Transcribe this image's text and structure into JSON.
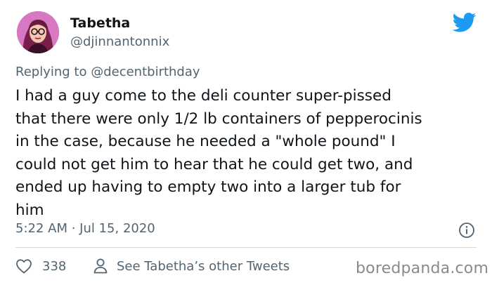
{
  "author": {
    "name": "Tabetha",
    "handle": "@djinnantonnix"
  },
  "reply": {
    "prefix": "Replying to ",
    "mention": "@decentbirthday"
  },
  "tweet": {
    "lines": [
      "I had a guy come to the deli counter super-pissed",
      "that there were only 1/2 lb containers of pepperocinis",
      "in the case, because he needed a \"whole pound\" I",
      "could not get him to hear that he could get two, and",
      "ended up having to empty two into a larger tub for",
      "him"
    ],
    "timestamp": "5:22 AM · Jul 15, 2020"
  },
  "actions": {
    "like_count": "338",
    "other_tweets_label": "See Tabetha’s other Tweets"
  },
  "watermark": "boredpanda.com",
  "icons": {
    "brand": "twitter-bird-icon",
    "info": "info-icon",
    "like": "heart-icon",
    "profile": "person-icon"
  },
  "colors": {
    "brand_blue": "#1d9bf0",
    "text_primary": "#0f1419",
    "text_secondary": "#536471",
    "divider": "#cfd9de"
  }
}
